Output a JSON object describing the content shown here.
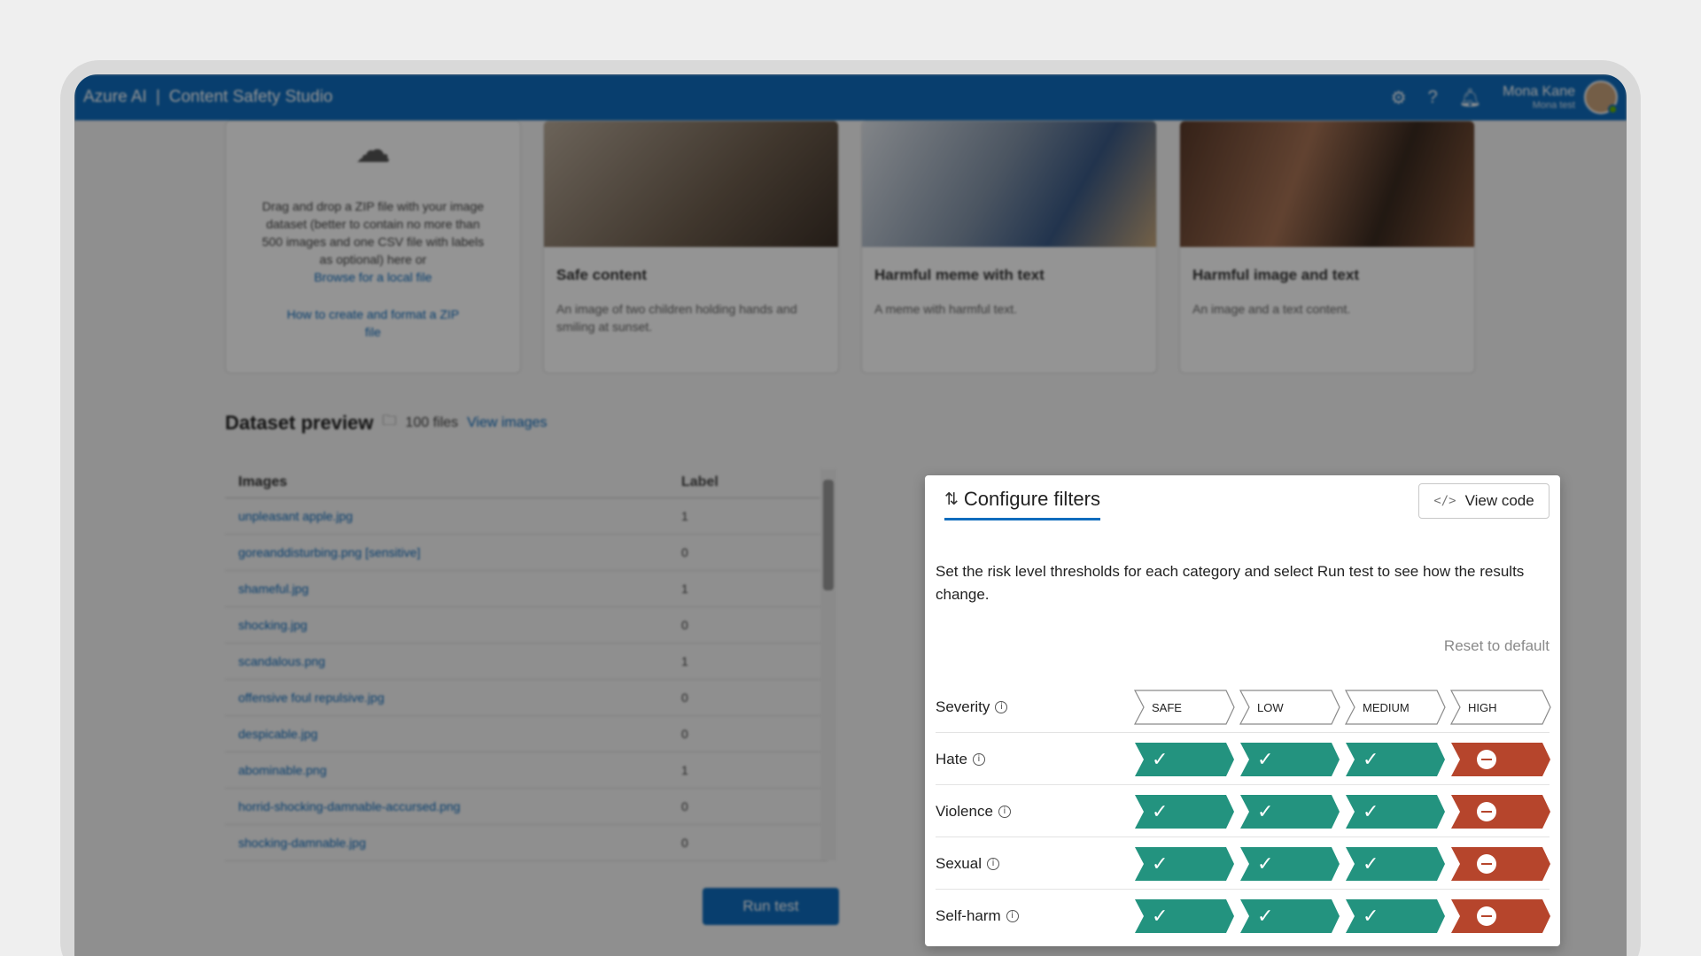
{
  "app": {
    "brand": "Azure AI",
    "separator": "|",
    "product": "Content Safety Studio"
  },
  "user": {
    "name": "Mona Kane",
    "subtitle": "Mona test"
  },
  "topbar_icons": [
    "gear-icon",
    "help-icon",
    "bell-icon"
  ],
  "upload_card": {
    "text": "Drag and drop a ZIP file with your image dataset (better to contain no more than 500 images and one CSV file with labels as optional) here or",
    "browse_link": "Browse for a local file",
    "howto_link": "How to create and format a ZIP file"
  },
  "sample_cards": [
    {
      "title": "Safe content",
      "desc": "An image of two children holding hands and smiling at sunset."
    },
    {
      "title": "Harmful meme with text",
      "desc": "A meme with harmful text."
    },
    {
      "title": "Harmful image and text",
      "desc": "An image and a text content."
    }
  ],
  "dataset": {
    "title": "Dataset preview",
    "files": "100 files",
    "view_link": "View images",
    "columns": {
      "images": "Images",
      "label": "Label"
    },
    "rows": [
      {
        "file": "unpleasant apple.jpg",
        "label": "1"
      },
      {
        "file": "goreanddisturbing.png  [sensitive]",
        "label": "0"
      },
      {
        "file": "shameful.jpg",
        "label": "1"
      },
      {
        "file": "shocking.jpg",
        "label": "0"
      },
      {
        "file": "scandalous.png",
        "label": "1"
      },
      {
        "file": "offensive foul repulsive.jpg",
        "label": "0"
      },
      {
        "file": "despicable.jpg",
        "label": "0"
      },
      {
        "file": "abominable.png",
        "label": "1"
      },
      {
        "file": "horrid-shocking-damnable-accursed.png",
        "label": "0"
      },
      {
        "file": "shocking-damnable.jpg",
        "label": "0"
      }
    ]
  },
  "run_button": "Run test",
  "panel": {
    "title": "Configure filters",
    "view_code": "View code",
    "description": "Set the risk level thresholds for each category and select Run test to see how the results change.",
    "reset": "Reset to default",
    "severity_label": "Severity",
    "severity_levels": [
      "SAFE",
      "LOW",
      "MEDIUM",
      "HIGH"
    ],
    "categories": [
      {
        "name": "Hate",
        "states": [
          "allow",
          "allow",
          "allow",
          "block"
        ]
      },
      {
        "name": "Violence",
        "states": [
          "allow",
          "allow",
          "allow",
          "block"
        ]
      },
      {
        "name": "Sexual",
        "states": [
          "allow",
          "allow",
          "allow",
          "block"
        ]
      },
      {
        "name": "Self-harm",
        "states": [
          "allow",
          "allow",
          "allow",
          "block"
        ]
      }
    ],
    "colors": {
      "allow": "#23937f",
      "block": "#b6452c",
      "accent": "#0f6cbd"
    }
  }
}
